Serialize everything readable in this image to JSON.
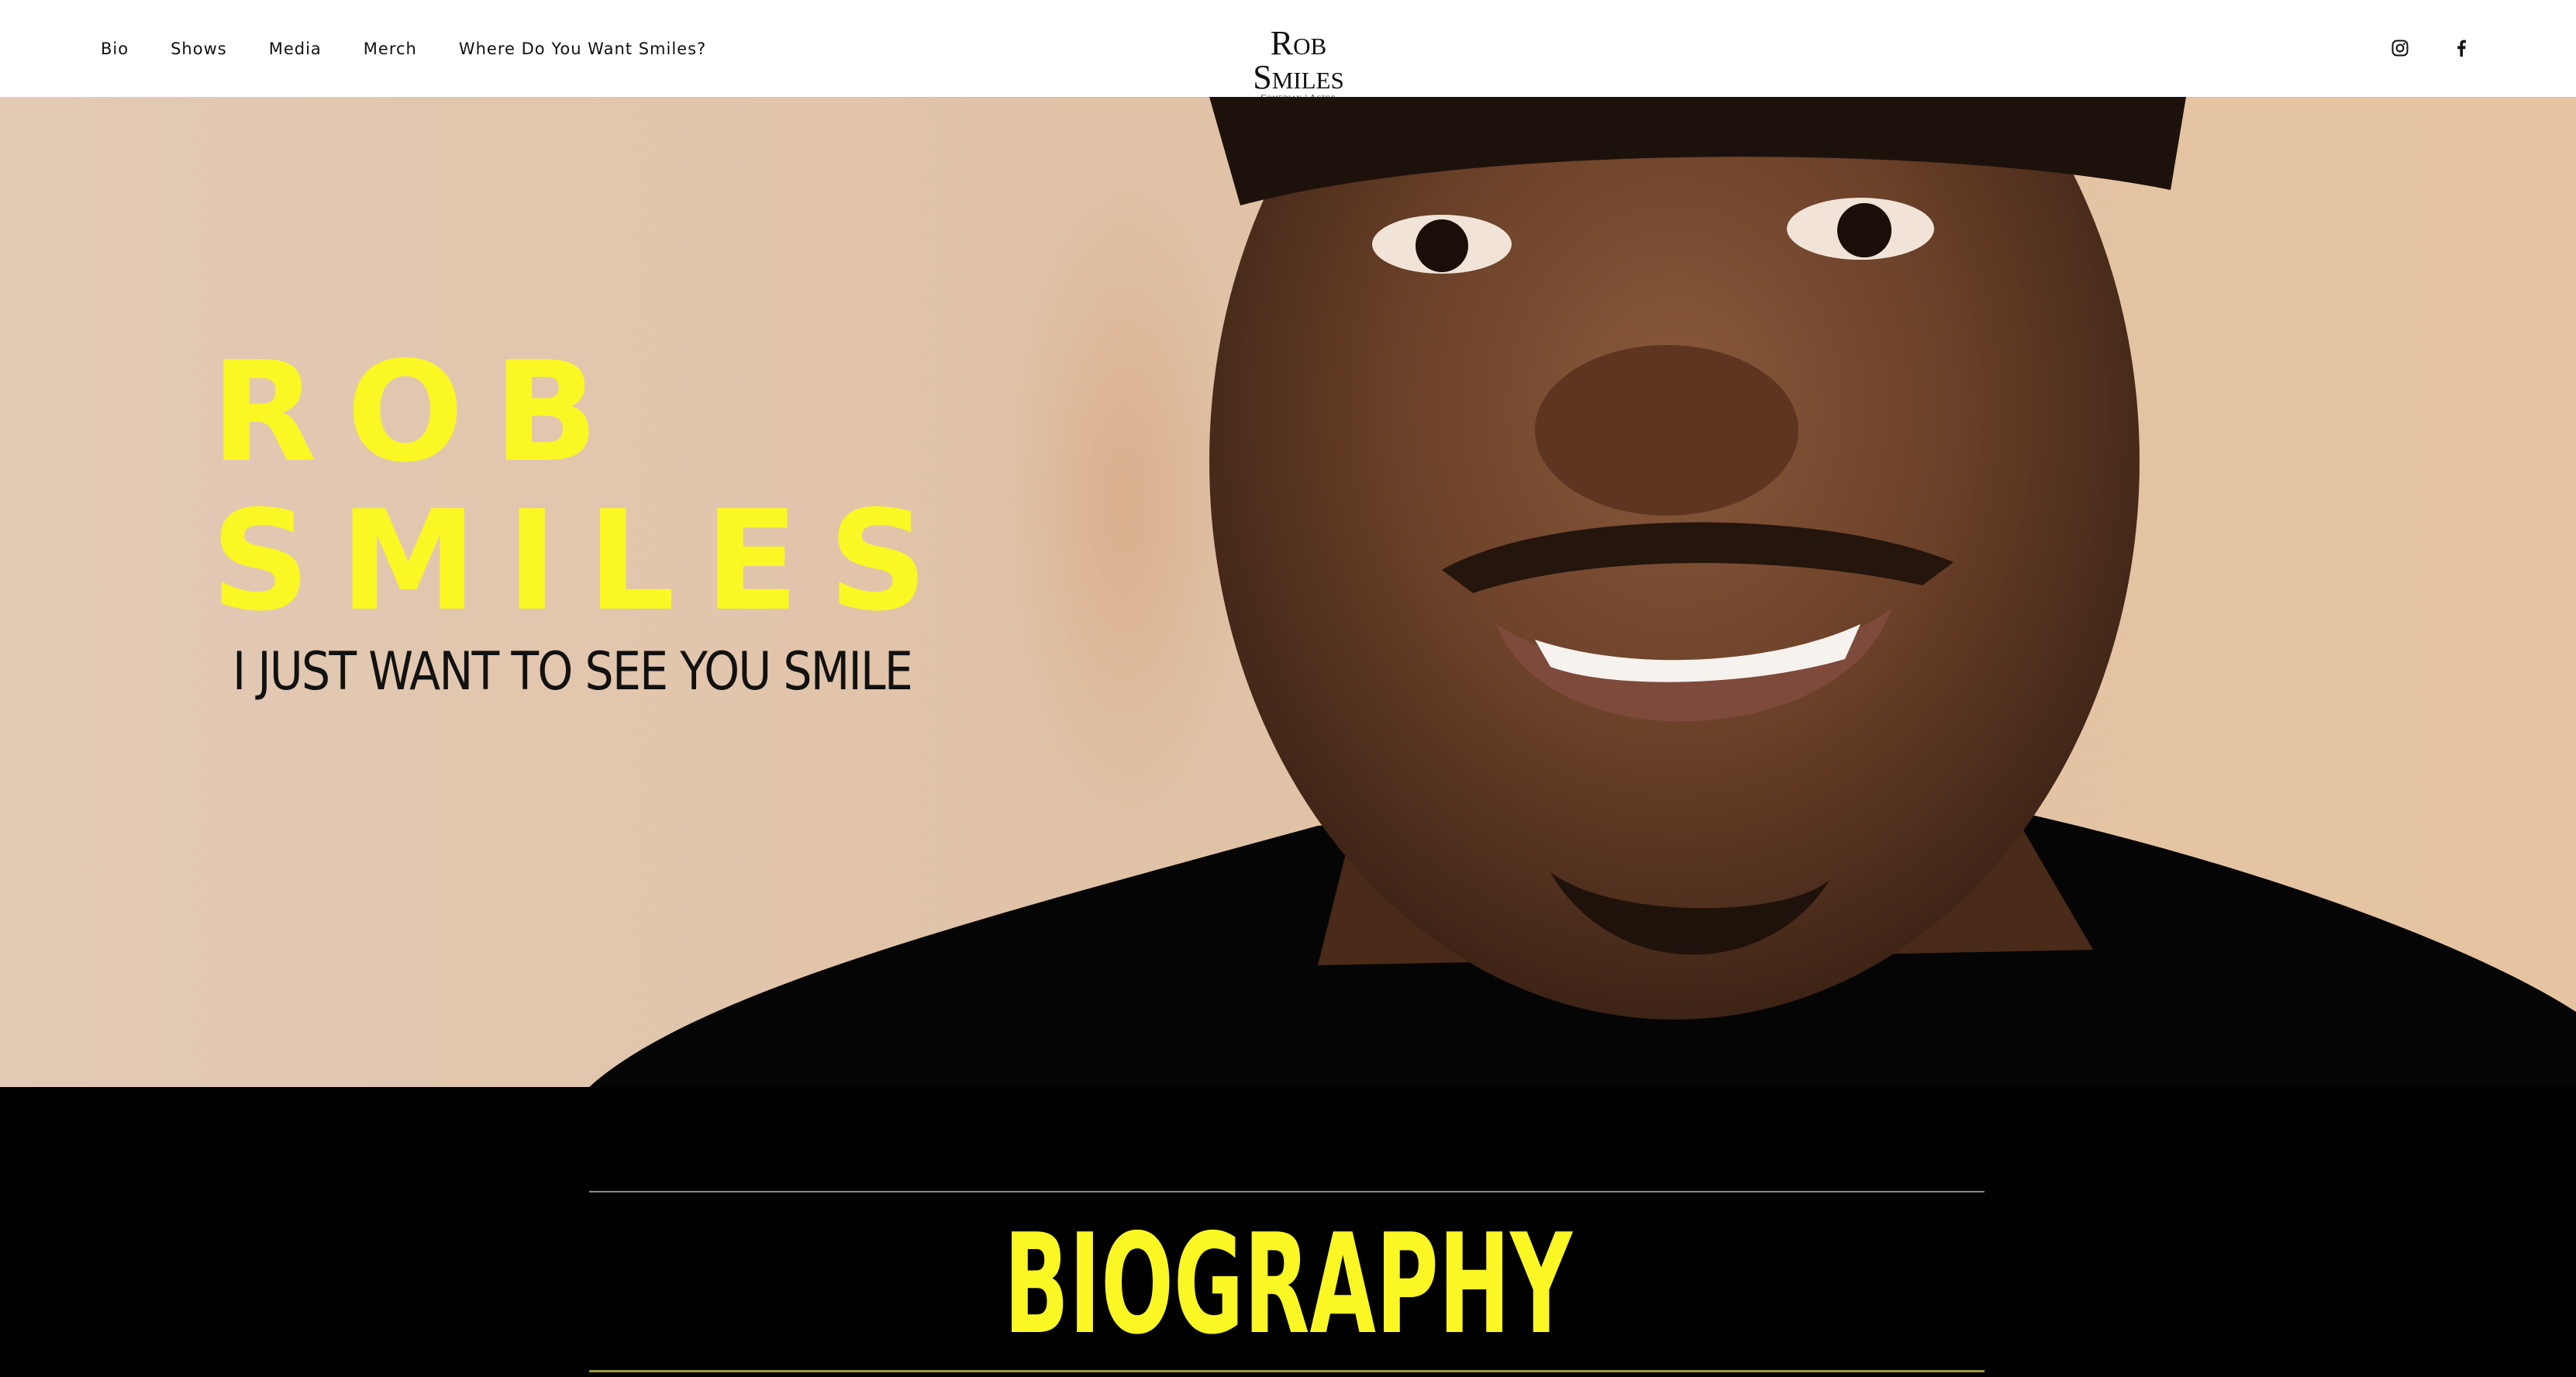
{
  "nav": {
    "items": [
      {
        "label": "Bio"
      },
      {
        "label": "Shows"
      },
      {
        "label": "Media"
      },
      {
        "label": "Merch"
      },
      {
        "label": "Where Do You Want Smiles?"
      }
    ]
  },
  "logo": {
    "main": "Rob Smiles",
    "sub": "Comedian | Actor"
  },
  "social": {
    "icons": [
      "instagram-icon",
      "facebook-icon"
    ]
  },
  "hero": {
    "title_line1": "ROB",
    "title_line2": "SMILES",
    "tagline": "I JUST WANT TO SEE YOU SMILE",
    "title_color": "#fbf724"
  },
  "biography": {
    "heading": "BIOGRAPHY",
    "heading_color": "#fbf724",
    "background": "#000000"
  }
}
